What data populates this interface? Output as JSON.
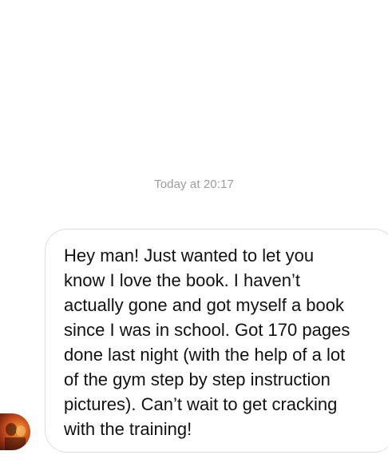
{
  "conversation": {
    "timestamp": "Today at 20:17",
    "message": {
      "text": "Hey man! Just wanted to let you\nknow I love the book. I haven’t\nactually gone and got myself a book\nsince I was in school. Got 170 pages\ndone last night (with the help of a lot\nof the gym step by step instruction\npictures). Can’t wait to get cracking\nwith the training!"
    },
    "sender": {
      "avatar_icon": "avatar-photo"
    }
  }
}
